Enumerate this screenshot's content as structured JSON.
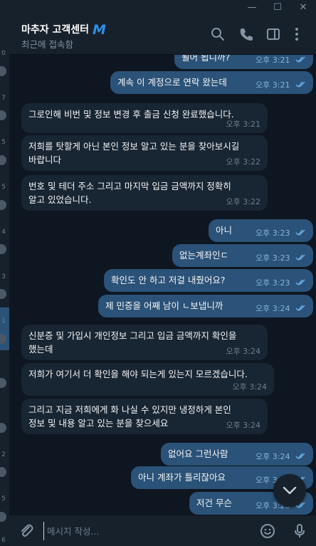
{
  "window": {
    "minimize": "—",
    "maximize": "☐",
    "close": "✕"
  },
  "header": {
    "title": "마추자 고객센터",
    "badge": "M",
    "status": "최근에 접속함"
  },
  "left_strip": {
    "digits": [
      "0",
      "7",
      "5",
      "5",
      "4",
      "3",
      "1",
      "2",
      "5",
      "6"
    ]
  },
  "messages": [
    {
      "dir": "out",
      "text": "될어 됩니까?",
      "time": "오후 3:21",
      "read": true
    },
    {
      "dir": "out",
      "text": "계속 이 계정으로 연락 왔는데",
      "time": "오후 3:21",
      "read": true
    },
    {
      "dir": "in",
      "text": "그로인해 비번 및 정보 변경 후 출금 신청 완료했습니다.",
      "time": "오후 3:21"
    },
    {
      "dir": "in",
      "text": "저희를 탓할게 아닌 본인 정보 알고 있는 분을 찾아보시길\n바랍니다",
      "time": "오후 3:22"
    },
    {
      "dir": "in",
      "text": "번호 및 테더 주소 그리고 마지막 입금 금액까지 정확히\n알고 있었습니다.",
      "time": "오후 3:22"
    },
    {
      "dir": "out",
      "text": "아니",
      "time": "오후 3:23",
      "read": true
    },
    {
      "dir": "out",
      "text": "없는계좌인ㄷ",
      "time": "오후 3:23",
      "read": true
    },
    {
      "dir": "out",
      "text": "확인도 안 하고 저걸 내줬어요?",
      "time": "오후 3:23",
      "read": true
    },
    {
      "dir": "out",
      "text": "제 민증을 어째 남이 ㄴ보냅니까",
      "time": "오후 3:24",
      "read": true
    },
    {
      "dir": "in",
      "text": "신분증 및 가입시 개인정보 그리고 입금 금액까지 확인을\n했는데",
      "time": "오후 3:24"
    },
    {
      "dir": "in",
      "text": "저희가 여기서 더 확인을 해야 되는게 있는지 모르겠습니다.",
      "time": "오후 3:24"
    },
    {
      "dir": "in",
      "text": "그리고 지금 저희에게 화 나실 수 있지만 냉정하게 본인\n정보 및 내용 알고 있는 분을 찾으세요",
      "time": "오후 3:24"
    },
    {
      "dir": "out",
      "text": "없어요 그런사람",
      "time": "오후 3:24",
      "read": true
    },
    {
      "dir": "out",
      "text": "아니 계좌가 틀리잖아요",
      "time": "오후 3:24",
      "read": true
    },
    {
      "dir": "out",
      "text": "저건 무슨",
      "time": "오후 3:25",
      "read": true
    }
  ],
  "composer": {
    "placeholder": "메시지 작성..."
  },
  "icons": {
    "search": "search-icon",
    "call": "phone-icon",
    "sidebar": "sidebar-toggle-icon",
    "more": "more-vertical-icon",
    "attach": "paperclip-icon",
    "emoji": "emoji-icon",
    "voice": "microphone-icon",
    "scroll_down": "chevron-down-icon"
  },
  "colors": {
    "background": "#0e1621",
    "panel": "#17212b",
    "outgoing_bubble": "#2b5278",
    "incoming_bubble": "#182533",
    "accent": "#2f8fe8"
  }
}
